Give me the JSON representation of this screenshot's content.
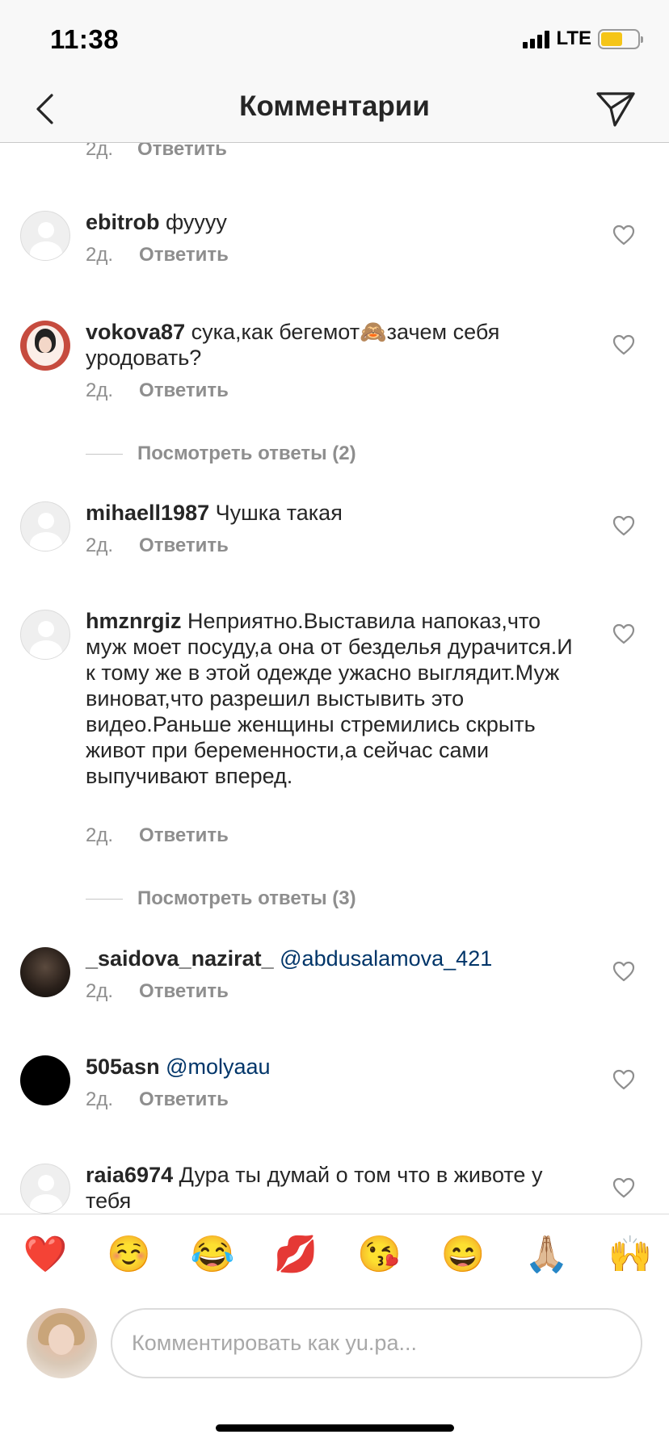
{
  "status_bar": {
    "time": "11:38",
    "network": "LTE"
  },
  "navbar": {
    "title": "Комментарии"
  },
  "partial_top": {
    "time": "2д.",
    "reply_label": "Ответить"
  },
  "comments": [
    {
      "username": "ebitrob",
      "text": " фуууу",
      "time": "2д.",
      "reply_label": "Ответить"
    },
    {
      "username": "vokova87",
      "text": " сука,как бегемот🙈зачем себя уродовать?",
      "time": "2д.",
      "reply_label": "Ответить"
    },
    {
      "username": "mihaell1987",
      "text": " Чушка такая",
      "time": "2д.",
      "reply_label": "Ответить"
    },
    {
      "username": "hmznrgiz",
      "text": " Неприятно.Выставила напоказ,что муж моет посуду,а она от безделья дурачится.И к тому же в этой одежде ужасно выглядит.Муж виноват,что разрешил выстывить это видео.Раньше женщины стремились скрыть живот при беременности,а сейчас сами выпучивают вперед.",
      "time": "2д.",
      "reply_label": "Ответить"
    },
    {
      "username": "_saidova_nazirat_",
      "mention": "@abdusalamova_421",
      "time": "2д.",
      "reply_label": "Ответить"
    },
    {
      "username": "505asn",
      "mention": "@molyaau",
      "time": "2д.",
      "reply_label": "Ответить"
    },
    {
      "username": "raia6974",
      "text": " Дура ты думай о том что в животе у тебя"
    }
  ],
  "view_replies": [
    {
      "label": "Посмотреть ответы (2)"
    },
    {
      "label": "Посмотреть ответы (3)"
    }
  ],
  "emoji_bar": [
    "❤️",
    "☺️",
    "😂",
    "💋",
    "😘",
    "😄",
    "🙏🏼",
    "🙌"
  ],
  "comment_input": {
    "placeholder": "Комментировать как yu.pa..."
  },
  "colors": {
    "text": "#262626",
    "secondary": "#8e8e8e",
    "mention": "#003569",
    "battery": "#f5c518"
  }
}
